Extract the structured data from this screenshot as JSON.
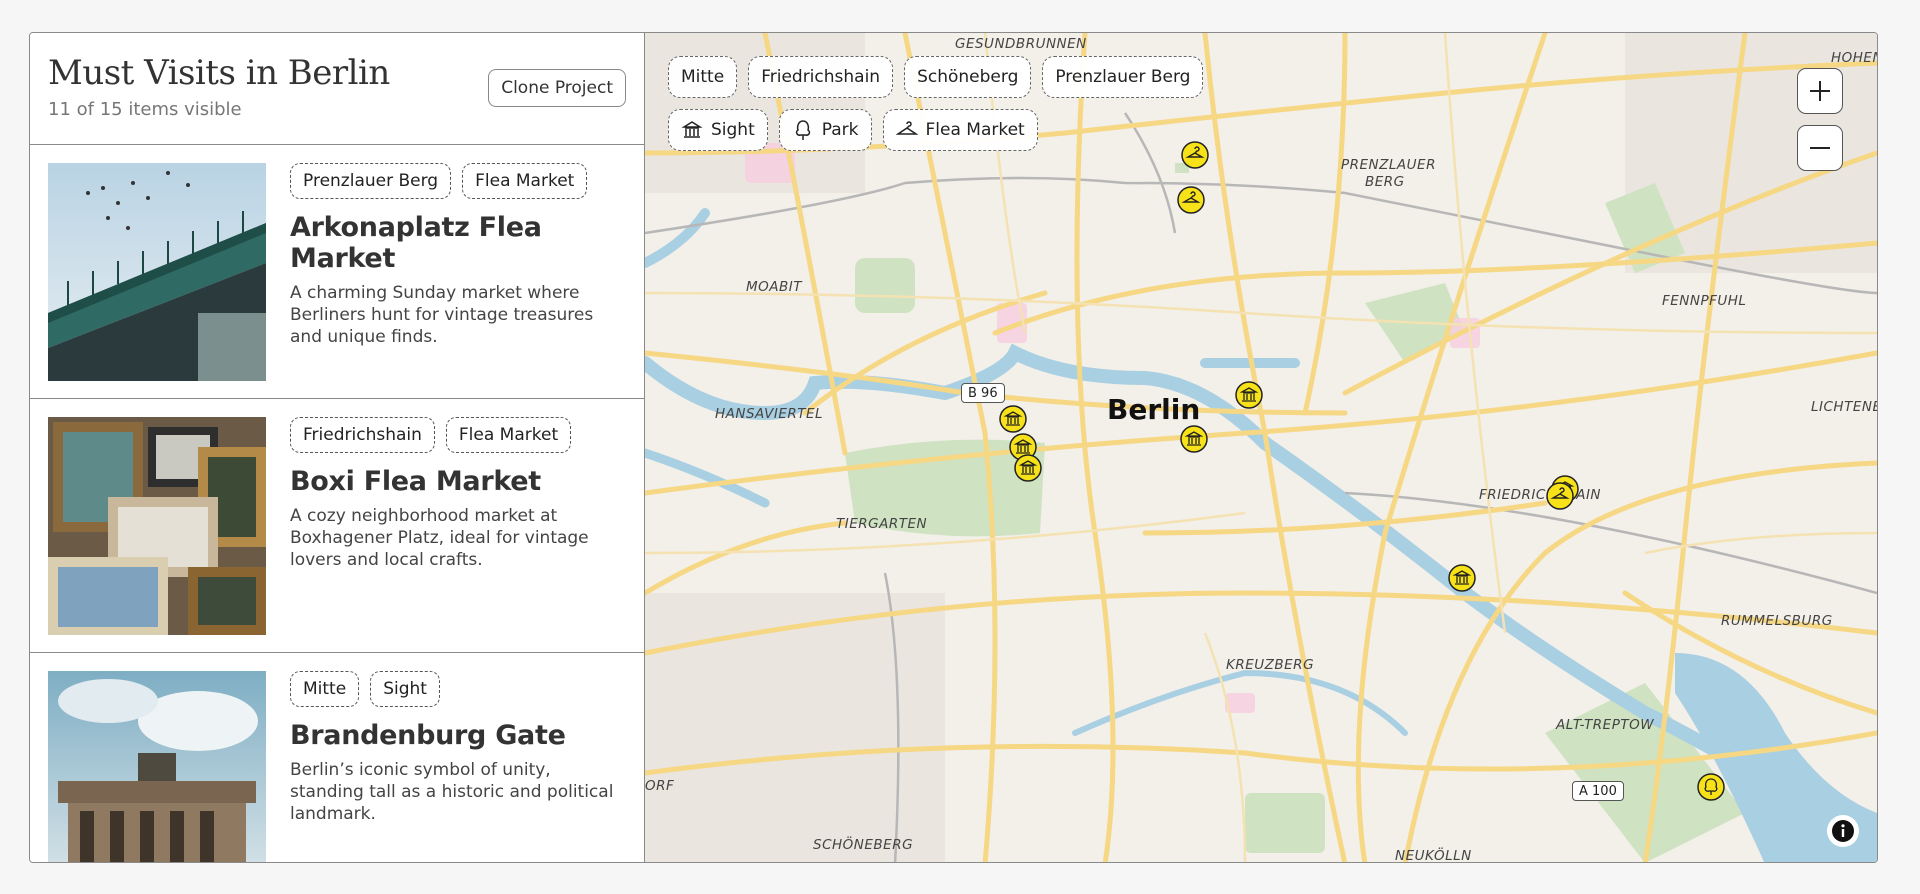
{
  "sidebar": {
    "title": "Must Visits in Berlin",
    "visible_count": "11 of 15 items visible",
    "clone_label": "Clone Project",
    "items": [
      {
        "tags": [
          "Prenzlauer Berg",
          "Flea Market"
        ],
        "title": "Arkonaplatz Flea Market",
        "description": "A charming Sunday market where Berliners hunt for vintage treasures and unique finds."
      },
      {
        "tags": [
          "Friedrichshain",
          "Flea Market"
        ],
        "title": "Boxi Flea Market",
        "description": "A cozy neighborhood market at Boxhagener Platz, ideal for vintage lovers and local crafts."
      },
      {
        "tags": [
          "Mitte",
          "Sight"
        ],
        "title": "Brandenburg Gate",
        "description": "Berlin’s iconic symbol of unity, standing tall as a historic and political landmark."
      }
    ]
  },
  "map": {
    "district_filters": [
      "Mitte",
      "Friedrichshain",
      "Schöneberg",
      "Prenzlauer Berg"
    ],
    "category_filters": [
      {
        "label": "Sight",
        "icon": "museum-icon"
      },
      {
        "label": "Park",
        "icon": "tree-icon"
      },
      {
        "label": "Flea Market",
        "icon": "hanger-icon"
      }
    ],
    "city_label": "Berlin",
    "place_labels": {
      "gesundbrunnen": "GESUNDBRUNNEN",
      "prenzlauer": "PRENZLAUER",
      "berg": "BERG",
      "moabit": "MOABIT",
      "hansaviertel": "HANSAVIERTEL",
      "tiergarten": "TIERGARTEN",
      "kreuzberg": "KREUZBERG",
      "friedrichshain": "FRIEDRICHSHAIN",
      "fennpfuhl": "FENNPFUHL",
      "lichtenberg": "LICHTENE",
      "rummelsburg": "RUMMELSBURG",
      "alt_treptow": "ALT-TREPTOW",
      "schoeneberg": "SCHÖNEBERG",
      "neukoelln": "NEUKÖLLN",
      "hohen": "HOHEN",
      "dorf": "ORF"
    },
    "road_shields": [
      "B 96",
      "A 100"
    ],
    "marker_color": "#f7e21a",
    "water_color": "#a9cfe3",
    "park_color": "#cfe3c2",
    "road_color": "#f6d784"
  }
}
